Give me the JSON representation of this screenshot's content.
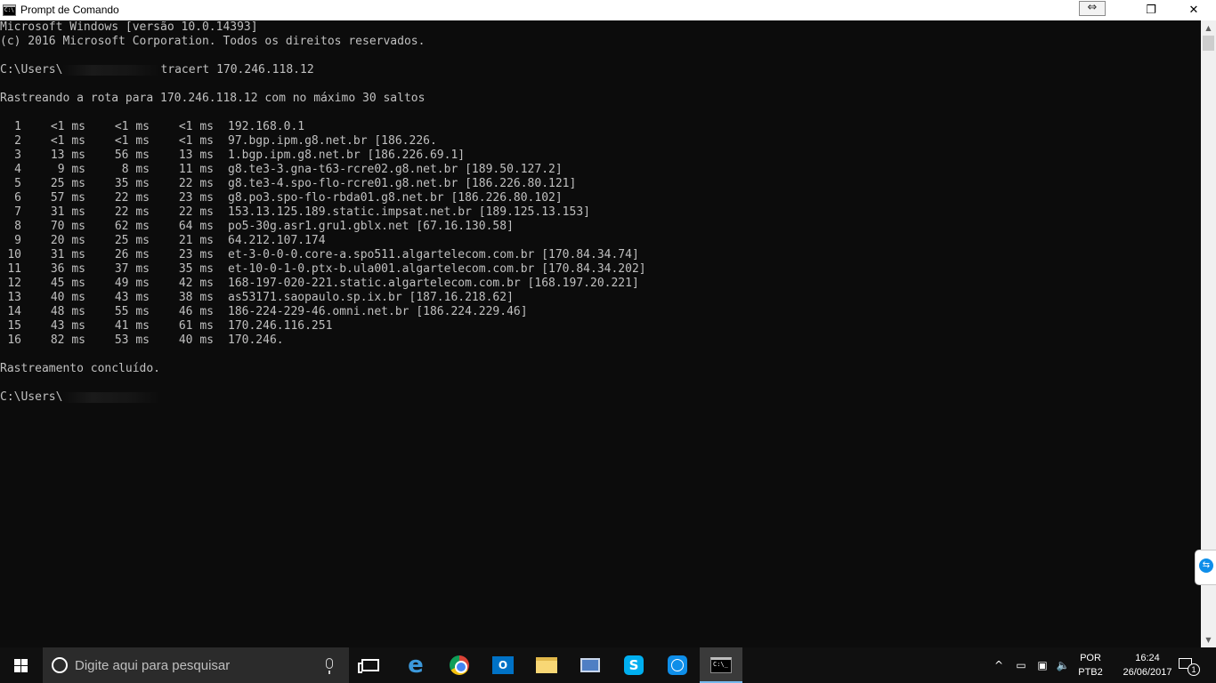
{
  "window": {
    "title": "Prompt de Comando",
    "icon_label": "C:\\",
    "controls": {
      "restore_icon": "⇔",
      "maximize_icon": "❐",
      "close_icon": "✕"
    }
  },
  "console": {
    "header": [
      "Microsoft Windows [versão 10.0.14393]",
      "(c) 2016 Microsoft Corporation. Todos os direitos reservados."
    ],
    "prompt_prefix": "C:\\Users\\",
    "command": "tracert 170.246.118.12",
    "trace_intro": "Rastreando a rota para 170.246.118.12 com no máximo 30 saltos",
    "hops": [
      {
        "n": "1",
        "t1": "<1 ms",
        "t2": "<1 ms",
        "t3": "<1 ms",
        "host": "192.168.0.1"
      },
      {
        "n": "2",
        "t1": "<1 ms",
        "t2": "<1 ms",
        "t3": "<1 ms",
        "host": "97.bgp.ipm.g8.net.br [186.226."
      },
      {
        "n": "3",
        "t1": "13 ms",
        "t2": "56 ms",
        "t3": "13 ms",
        "host": "1.bgp.ipm.g8.net.br [186.226.69.1]"
      },
      {
        "n": "4",
        "t1": "9 ms",
        "t2": "8 ms",
        "t3": "11 ms",
        "host": "g8.te3-3.gna-t63-rcre02.g8.net.br [189.50.127.2]"
      },
      {
        "n": "5",
        "t1": "25 ms",
        "t2": "35 ms",
        "t3": "22 ms",
        "host": "g8.te3-4.spo-flo-rcre01.g8.net.br [186.226.80.121]"
      },
      {
        "n": "6",
        "t1": "57 ms",
        "t2": "22 ms",
        "t3": "23 ms",
        "host": "g8.po3.spo-flo-rbda01.g8.net.br [186.226.80.102]"
      },
      {
        "n": "7",
        "t1": "31 ms",
        "t2": "22 ms",
        "t3": "22 ms",
        "host": "153.13.125.189.static.impsat.net.br [189.125.13.153]"
      },
      {
        "n": "8",
        "t1": "70 ms",
        "t2": "62 ms",
        "t3": "64 ms",
        "host": "po5-30g.asr1.gru1.gblx.net [67.16.130.58]"
      },
      {
        "n": "9",
        "t1": "20 ms",
        "t2": "25 ms",
        "t3": "21 ms",
        "host": "64.212.107.174"
      },
      {
        "n": "10",
        "t1": "31 ms",
        "t2": "26 ms",
        "t3": "23 ms",
        "host": "et-3-0-0-0.core-a.spo511.algartelecom.com.br [170.84.34.74]"
      },
      {
        "n": "11",
        "t1": "36 ms",
        "t2": "37 ms",
        "t3": "35 ms",
        "host": "et-10-0-1-0.ptx-b.ula001.algartelecom.com.br [170.84.34.202]"
      },
      {
        "n": "12",
        "t1": "45 ms",
        "t2": "49 ms",
        "t3": "42 ms",
        "host": "168-197-020-221.static.algartelecom.com.br [168.197.20.221]"
      },
      {
        "n": "13",
        "t1": "40 ms",
        "t2": "43 ms",
        "t3": "38 ms",
        "host": "as53171.saopaulo.sp.ix.br [187.16.218.62]"
      },
      {
        "n": "14",
        "t1": "48 ms",
        "t2": "55 ms",
        "t3": "46 ms",
        "host": "186-224-229-46.omni.net.br [186.224.229.46]"
      },
      {
        "n": "15",
        "t1": "43 ms",
        "t2": "41 ms",
        "t3": "61 ms",
        "host": "170.246.116.251"
      },
      {
        "n": "16",
        "t1": "82 ms",
        "t2": "53 ms",
        "t3": "40 ms",
        "host": "170.246."
      }
    ],
    "trace_done": "Rastreamento concluído."
  },
  "scrollbar": {
    "up_icon": "▲",
    "down_icon": "▼"
  },
  "taskbar": {
    "search_placeholder": "Digite aqui para pesquisar",
    "outlook_label": "O",
    "skype_label": "S",
    "cmd_label": "C:\\_",
    "edge_label": "e",
    "tray": {
      "chevron_icon": "^",
      "battery_icon": "▭",
      "network_icon": "▣",
      "volume_icon": "🔈",
      "lang_line1": "POR",
      "lang_line2": "PTB2",
      "time": "16:24",
      "date": "26/06/2017",
      "notification_count": "1"
    }
  }
}
